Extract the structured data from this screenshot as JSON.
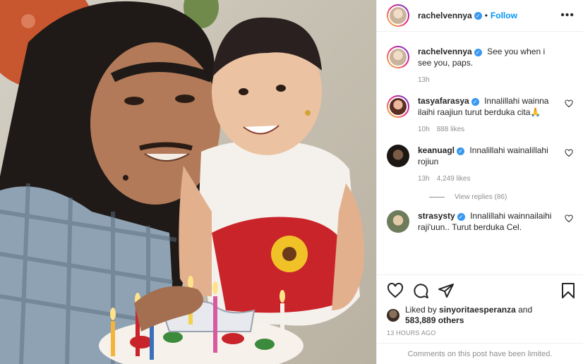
{
  "post": {
    "photo_alt": "",
    "author": {
      "username": "rachelvennya",
      "follow_label": "Follow",
      "separator": "•"
    },
    "more_label": "•••"
  },
  "comments": [
    {
      "username": "rachelvennya",
      "text": "See you when i see you, paps.",
      "time": "13h",
      "likes": ""
    },
    {
      "username": "tasyafarasya",
      "text": "Innalillahi wainna ilaihi raajiun turut berduka cita🙏",
      "time": "10h",
      "likes": "888 likes"
    },
    {
      "username": "keanuagl",
      "text": "Innalillahi wainalillahi rojiun",
      "time": "13h",
      "likes": "4,249 likes"
    },
    {
      "username": "strasysty",
      "text": "Innalillahi wainnailaihi raji'uun.. Turut berduka Cel.",
      "time": "",
      "likes": ""
    }
  ],
  "view_replies": "View replies (86)",
  "likes": {
    "prefix": "Liked by",
    "user": "sinyoritaesperanza",
    "and": "and",
    "others": "583,889 others"
  },
  "time_ago": "13 HOURS AGO",
  "footer_note": "Comments on this post have been limited.",
  "colors": {
    "accent": "#0095f6",
    "verified": "#3897f0",
    "muted": "#8e8e8e"
  }
}
